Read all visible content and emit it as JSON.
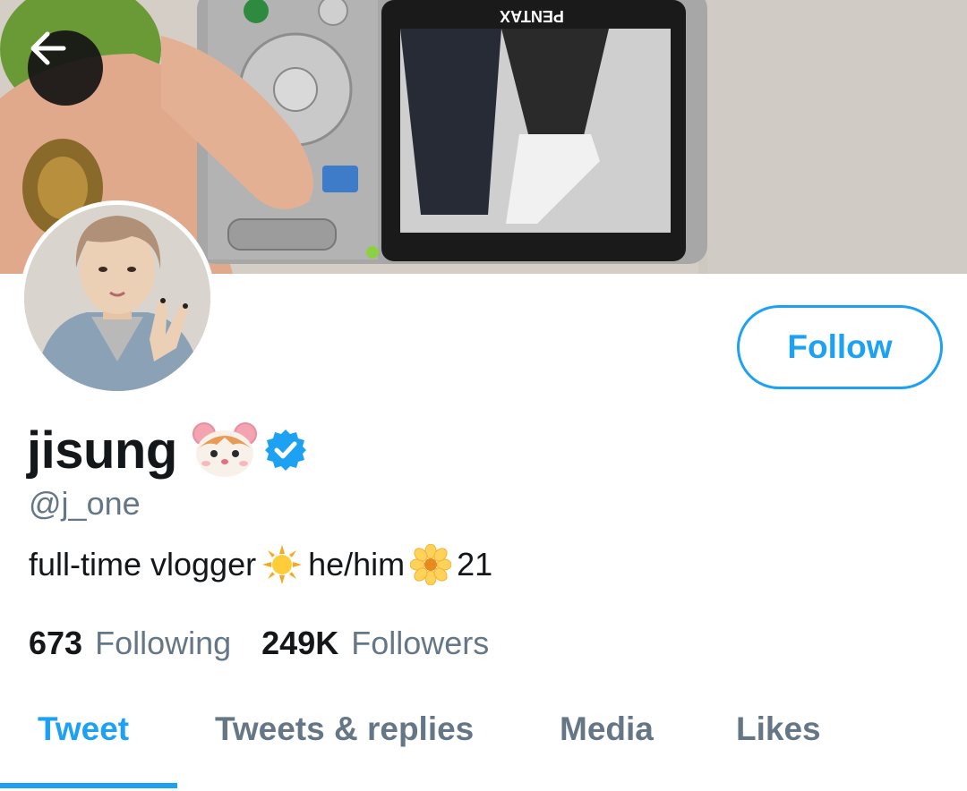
{
  "header": {
    "back_icon": "arrow-left-icon",
    "banner_camera_brand": "PENTAX"
  },
  "profile": {
    "display_name": "jisung",
    "name_emoji": "hamster-face-icon",
    "verified_icon": "verified-badge-icon",
    "handle": "@j_one",
    "bio_part1": "full-time vlogger",
    "bio_emoji1": "sun-icon",
    "bio_part2": "he/him",
    "bio_emoji2": "blossom-icon",
    "bio_part3": "21"
  },
  "actions": {
    "follow_label": "Follow"
  },
  "stats": {
    "following_count": "673",
    "following_label": "Following",
    "followers_count": "249K",
    "followers_label": "Followers"
  },
  "tabs": [
    {
      "label": "Tweet",
      "active": true
    },
    {
      "label": "Tweets & replies",
      "active": false
    },
    {
      "label": "Media",
      "active": false
    },
    {
      "label": "Likes",
      "active": false
    }
  ],
  "colors": {
    "accent": "#1da1f2",
    "text_primary": "#14171a",
    "text_secondary": "#657786"
  }
}
